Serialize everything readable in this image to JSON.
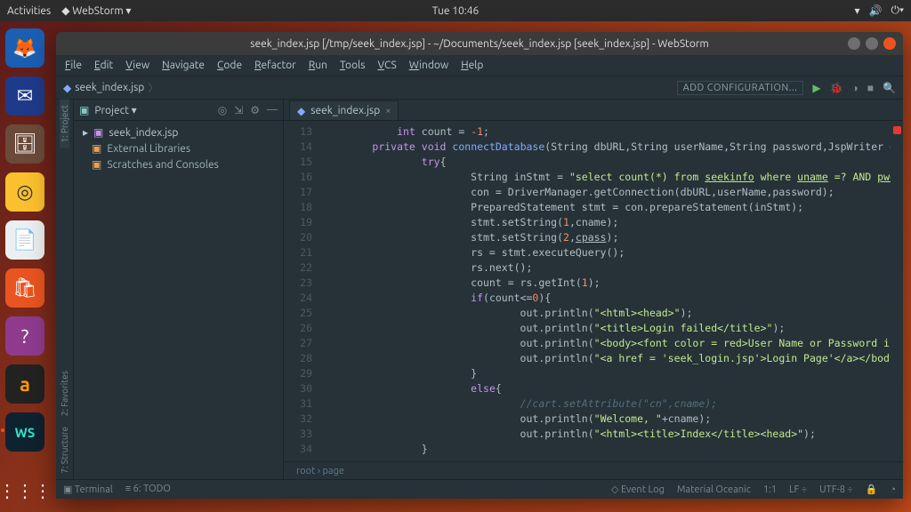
{
  "desktop": {
    "activities": "Activities",
    "appmenu": "WebStorm ▾",
    "clock": "Tue 10:46"
  },
  "window": {
    "title": "seek_index.jsp [/tmp/seek_index.jsp] - ~/Documents/seek_index.jsp [seek_index.jsp] - WebStorm"
  },
  "menu": [
    "File",
    "Edit",
    "View",
    "Navigate",
    "Code",
    "Refactor",
    "Run",
    "Tools",
    "VCS",
    "Window",
    "Help"
  ],
  "crumb": "seek_index.jsp",
  "toolbar": {
    "addconf": "ADD CONFIGURATION..."
  },
  "leftpanels": {
    "project": "1: Project",
    "favorites": "2: Favorites",
    "structure": "7: Structure"
  },
  "sidebar": {
    "heading": "Project ▾",
    "items": [
      {
        "label": "seek_index.jsp",
        "kind": "root"
      },
      {
        "label": "External Libraries",
        "kind": "lib"
      },
      {
        "label": "Scratches and Consoles",
        "kind": "scratch"
      }
    ]
  },
  "tab": {
    "label": "seek_index.jsp"
  },
  "code_start_line": 13,
  "code_lines": [
    {
      "indent": 3,
      "html": "<span class='k'>int</span> count = <span class='n'>-1</span>;"
    },
    {
      "indent": 2,
      "html": "<span class='k'>private void</span> <span class='i'>connectDatabase</span>(String dbURL,String userName,String password,JspWriter out){"
    },
    {
      "indent": 4,
      "html": "<span class='k'>try</span>{"
    },
    {
      "indent": 6,
      "html": "String inStmt = <span class='s'>\"select count(*) from <span class='ul'>seekinfo</span> where <span class='ul'>uname</span> =? AND <span class='ul'>pword</span>=?\"</span>;"
    },
    {
      "indent": 6,
      "html": "con = DriverManager.getConnection(dbURL,userName,password);"
    },
    {
      "indent": 6,
      "html": "PreparedStatement stmt = con.prepareStatement(inStmt);"
    },
    {
      "indent": 6,
      "html": "stmt.setString(<span class='n'>1</span>,cname);"
    },
    {
      "indent": 6,
      "html": "stmt.setString(<span class='n'>2</span>,<span class='ul'>cpass</span>);"
    },
    {
      "indent": 6,
      "html": "rs = stmt.executeQuery();"
    },
    {
      "indent": 6,
      "html": "rs.next();"
    },
    {
      "indent": 6,
      "html": "count = rs.getInt(<span class='n'>1</span>);"
    },
    {
      "indent": 6,
      "html": "<span class='k'>if</span>(count&lt;=<span class='n'>0</span>){"
    },
    {
      "indent": 8,
      "html": "out.println(<span class='s'>\"&lt;html&gt;&lt;head&gt;\"</span>);"
    },
    {
      "indent": 8,
      "html": "out.println(<span class='s'>\"&lt;title&gt;Login failed&lt;/title&gt;\"</span>);"
    },
    {
      "indent": 8,
      "html": "out.println(<span class='s'>\"&lt;body&gt;&lt;font color = red&gt;User Name or Password is Invalid&lt;/font&gt;&lt;br&gt;\"</span>);"
    },
    {
      "indent": 8,
      "html": "out.println(<span class='s'>\"&lt;a href = 'seek_login.jsp'&gt;Login Page'&lt;/a&gt;&lt;/body&gt;&lt;/html&gt;\"</span>);"
    },
    {
      "indent": 6,
      "html": "}"
    },
    {
      "indent": 6,
      "html": "<span class='k'>else</span>{"
    },
    {
      "indent": 8,
      "html": "<span class='c'>//cart.setAttribute(\"cn\",cname);</span>"
    },
    {
      "indent": 8,
      "html": "out.println(<span class='s'>\"Welcome, \"</span>+cname);"
    },
    {
      "indent": 8,
      "html": "out.println(<span class='s'>\"&lt;html&gt;&lt;title&gt;Index&lt;/title&gt;&lt;head&gt;\"</span>);"
    },
    {
      "indent": 4,
      "html": "}"
    }
  ],
  "editor_breadcrumb": "root  ›  page",
  "status": {
    "terminal": "Terminal",
    "todo": "6: TODO",
    "eventlog": "Event Log",
    "theme": "Material Oceanic",
    "pos": "1:1",
    "le": "LF",
    "enc": "UTF-8"
  }
}
